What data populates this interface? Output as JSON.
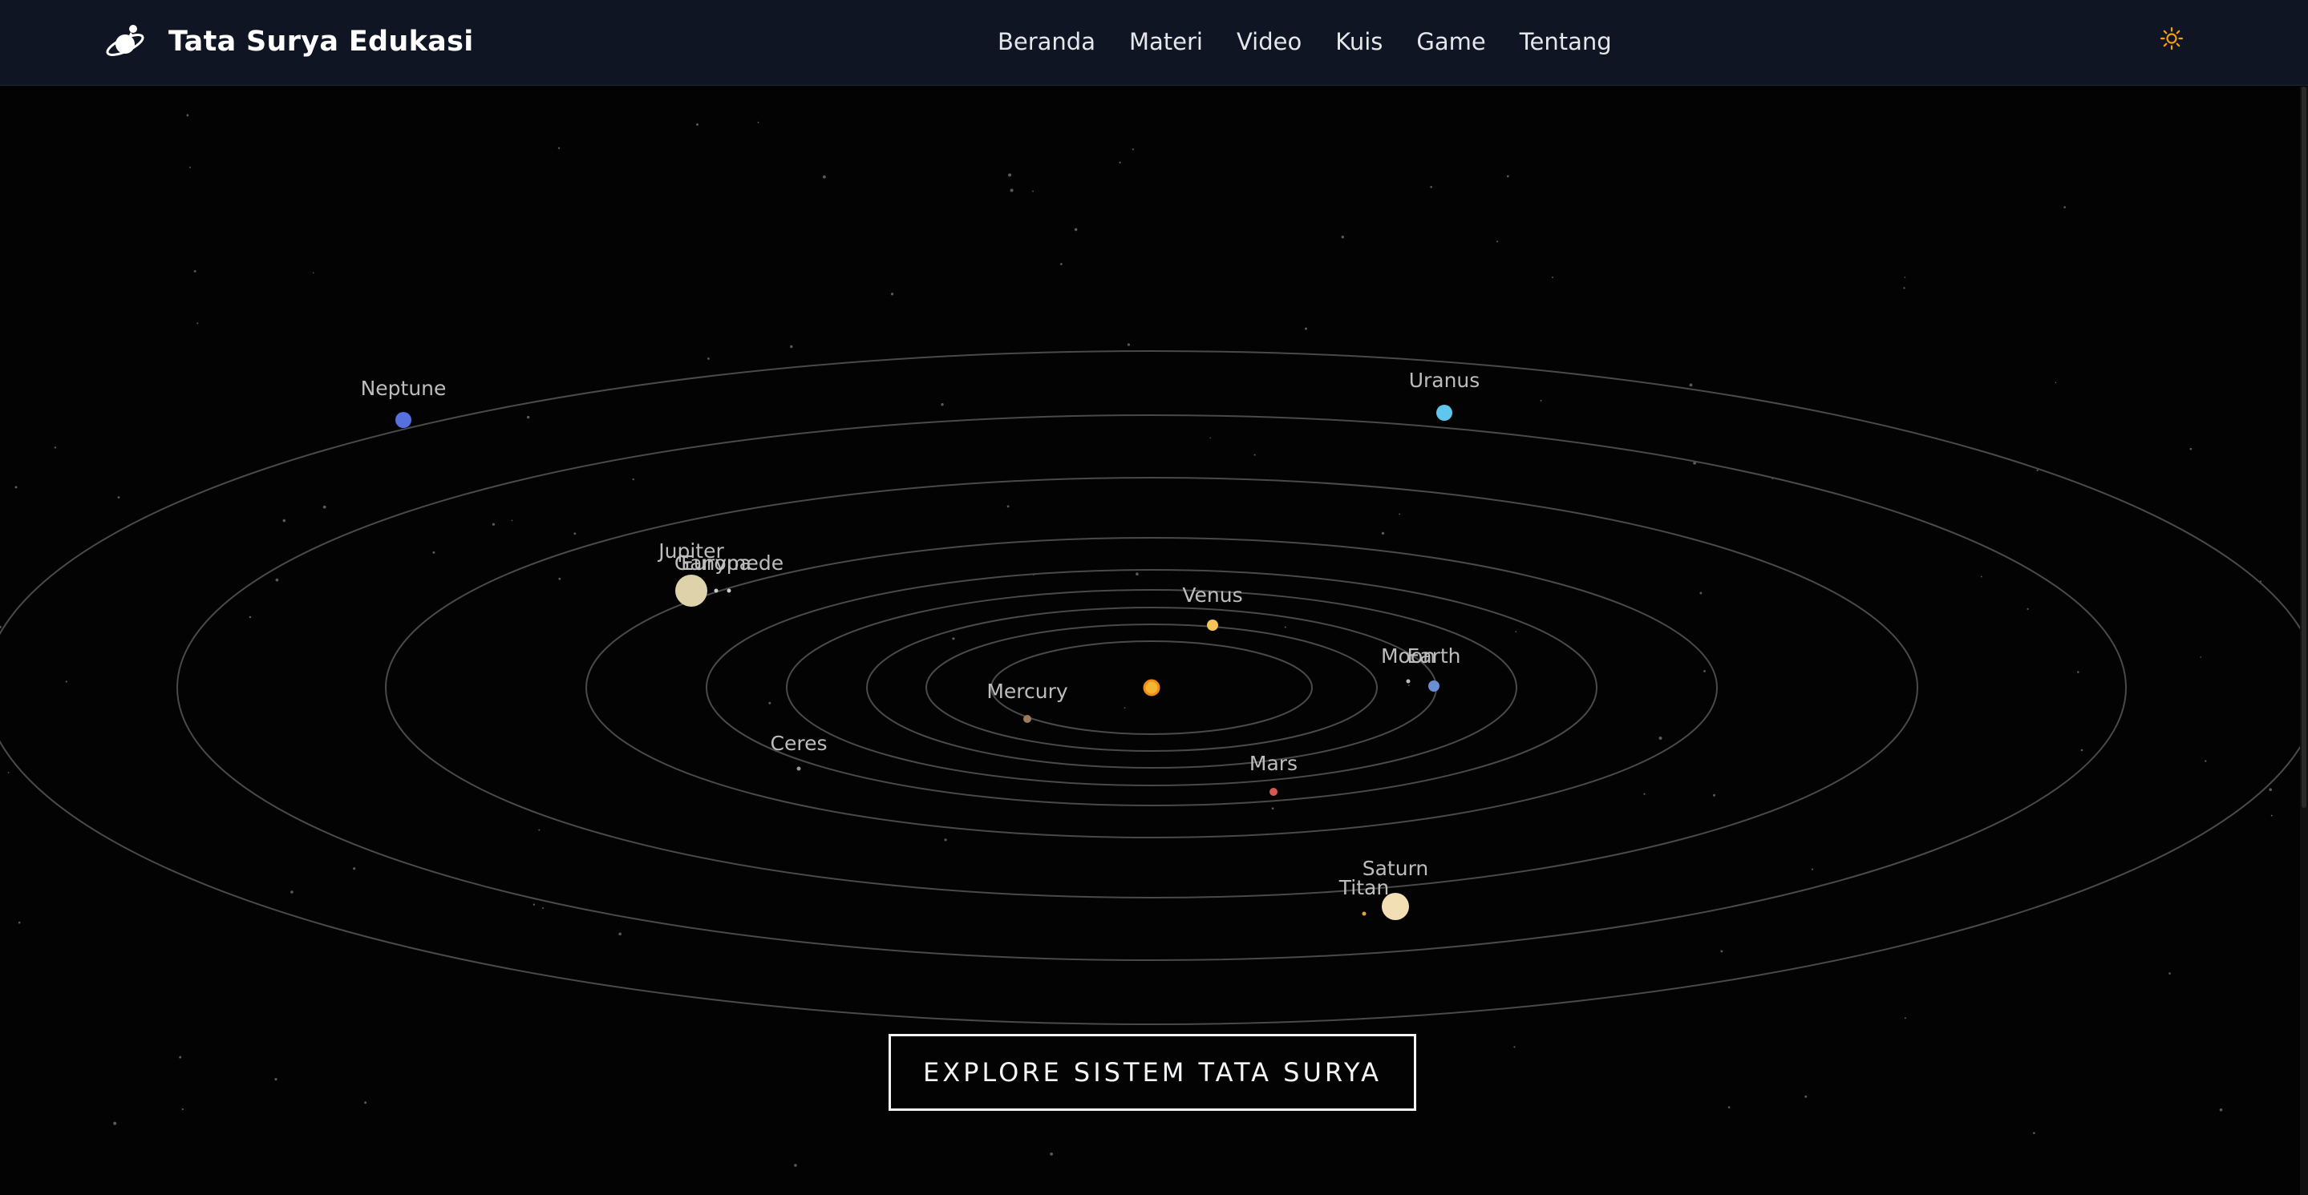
{
  "brand": {
    "title": "Tata Surya Edukasi",
    "logo_icon": "planet-astronaut-icon"
  },
  "nav": {
    "links": [
      "Beranda",
      "Materi",
      "Video",
      "Kuis",
      "Game",
      "Tentang"
    ]
  },
  "theme_toggle": {
    "icon": "sun-icon",
    "color": "#f59e0b"
  },
  "solar_system": {
    "sun": {
      "name": "Sun",
      "color": "#f5b432"
    },
    "bodies": [
      {
        "name": "Mercury",
        "color": "#9c7a5a"
      },
      {
        "name": "Venus",
        "color": "#f5c25b"
      },
      {
        "name": "Earth",
        "color": "#6b8fd6"
      },
      {
        "name": "Moon",
        "color": "#bbbbbb"
      },
      {
        "name": "Mars",
        "color": "#d9584e"
      },
      {
        "name": "Ceres",
        "color": "#999999"
      },
      {
        "name": "Jupiter",
        "color": "#ddd2aa"
      },
      {
        "name": "Europa",
        "color": "#cccccc"
      },
      {
        "name": "Ganymede",
        "color": "#cccccc"
      },
      {
        "name": "Saturn",
        "color": "#f3dfb4"
      },
      {
        "name": "Titan",
        "color": "#e0a341"
      },
      {
        "name": "Uranus",
        "color": "#5fc6ee"
      },
      {
        "name": "Neptune",
        "color": "#5670e0"
      }
    ],
    "orbit_color": "#4a4a4a",
    "label_color": "#bdbdbd"
  },
  "cta": {
    "label": "EXPLORE SISTEM TATA SURYA"
  }
}
